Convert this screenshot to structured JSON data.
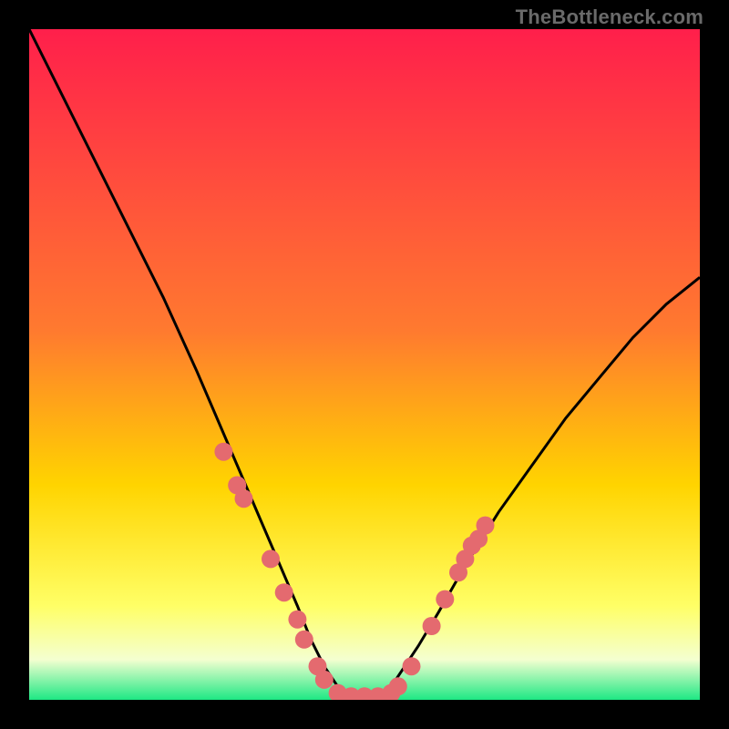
{
  "watermark": "TheBottleneck.com",
  "colors": {
    "black": "#000000",
    "curve": "#000000",
    "dot": "#e46a6f",
    "grad_top": "#ff1f4b",
    "grad_mid1": "#ff7a2f",
    "grad_mid2": "#ffd400",
    "grad_mid3": "#ffff66",
    "grad_mid4": "#f4ffd0",
    "grad_bottom": "#1ee884"
  },
  "chart_data": {
    "type": "line",
    "title": "",
    "xlabel": "",
    "ylabel": "",
    "xlim": [
      0,
      100
    ],
    "ylim": [
      0,
      100
    ],
    "series": [
      {
        "name": "bottleneck-curve",
        "x": [
          0,
          5,
          10,
          15,
          20,
          25,
          28,
          31,
          34,
          37,
          40,
          42,
          44,
          46,
          48,
          50,
          52,
          54,
          56,
          58,
          61,
          65,
          70,
          75,
          80,
          85,
          90,
          95,
          100
        ],
        "y": [
          100,
          90,
          80,
          70,
          60,
          49,
          42,
          35,
          28,
          21,
          14,
          9,
          5,
          2,
          0.5,
          0,
          0.5,
          2,
          5,
          8,
          13,
          20,
          28,
          35,
          42,
          48,
          54,
          59,
          63
        ]
      }
    ],
    "scatter": [
      {
        "name": "marker-cluster",
        "points": [
          {
            "x": 29,
            "y": 37
          },
          {
            "x": 31,
            "y": 32
          },
          {
            "x": 32,
            "y": 30
          },
          {
            "x": 36,
            "y": 21
          },
          {
            "x": 38,
            "y": 16
          },
          {
            "x": 40,
            "y": 12
          },
          {
            "x": 41,
            "y": 9
          },
          {
            "x": 43,
            "y": 5
          },
          {
            "x": 44,
            "y": 3
          },
          {
            "x": 46,
            "y": 1
          },
          {
            "x": 48,
            "y": 0.5
          },
          {
            "x": 50,
            "y": 0.5
          },
          {
            "x": 52,
            "y": 0.5
          },
          {
            "x": 54,
            "y": 1
          },
          {
            "x": 55,
            "y": 2
          },
          {
            "x": 57,
            "y": 5
          },
          {
            "x": 60,
            "y": 11
          },
          {
            "x": 62,
            "y": 15
          },
          {
            "x": 64,
            "y": 19
          },
          {
            "x": 65,
            "y": 21
          },
          {
            "x": 66,
            "y": 23
          },
          {
            "x": 67,
            "y": 24
          },
          {
            "x": 68,
            "y": 26
          }
        ]
      }
    ],
    "gradient_stops": [
      {
        "pos": 0.0,
        "hint": "red"
      },
      {
        "pos": 0.45,
        "hint": "orange"
      },
      {
        "pos": 0.68,
        "hint": "yellow"
      },
      {
        "pos": 0.86,
        "hint": "pale-yellow"
      },
      {
        "pos": 0.94,
        "hint": "near-white"
      },
      {
        "pos": 1.0,
        "hint": "green"
      }
    ]
  }
}
